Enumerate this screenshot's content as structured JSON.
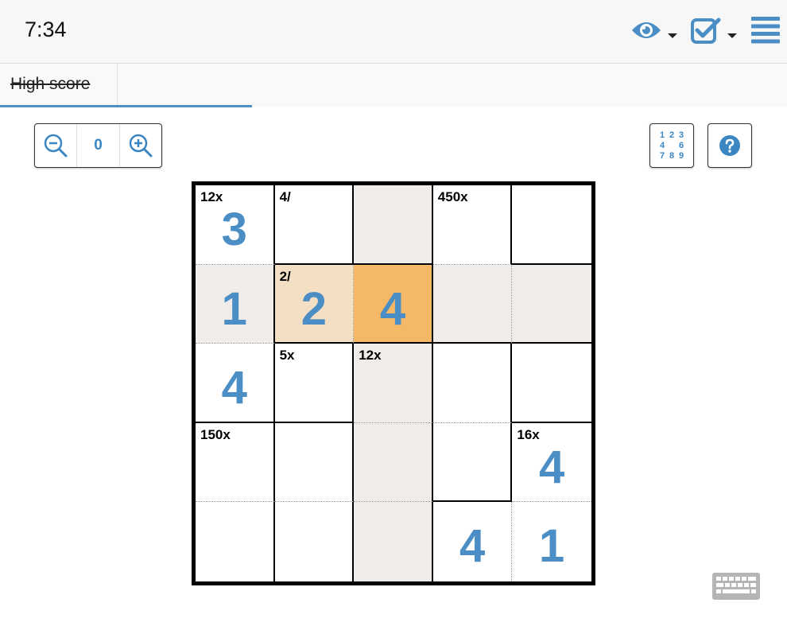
{
  "header": {
    "timer": "7:34",
    "icons": [
      "eye-icon",
      "check-square-icon",
      "menu-icon"
    ],
    "accent": "#4a8ec5"
  },
  "tabs": [
    {
      "label": "High score",
      "struck": true
    }
  ],
  "zoom": {
    "level": "0"
  },
  "numpad_button": {
    "digits": [
      "1",
      "2",
      "3",
      "4",
      "",
      "6",
      "7",
      "8",
      "9"
    ]
  },
  "puzzle": {
    "size": 5,
    "cages": [
      {
        "label": "12x",
        "row": 0,
        "col": 0
      },
      {
        "label": "4/",
        "row": 0,
        "col": 1
      },
      {
        "label": "450x",
        "row": 0,
        "col": 3
      },
      {
        "label": "2/",
        "row": 1,
        "col": 1
      },
      {
        "label": "5x",
        "row": 2,
        "col": 1
      },
      {
        "label": "12x",
        "row": 2,
        "col": 2
      },
      {
        "label": "150x",
        "row": 3,
        "col": 0
      },
      {
        "label": "16x",
        "row": 3,
        "col": 4
      }
    ],
    "values": [
      [
        "3",
        "",
        "",
        "",
        ""
      ],
      [
        "1",
        "2",
        "4",
        "",
        ""
      ],
      [
        "4",
        "",
        "",
        "",
        ""
      ],
      [
        "",
        "",
        "",
        "",
        "4"
      ],
      [
        "",
        "",
        "",
        "4",
        "1"
      ]
    ],
    "selected": {
      "row": 1,
      "col": 2
    },
    "colors": {
      "highlight": "#f0ece9",
      "peer": "#f3dfc3",
      "selected": "#f5b866"
    }
  }
}
